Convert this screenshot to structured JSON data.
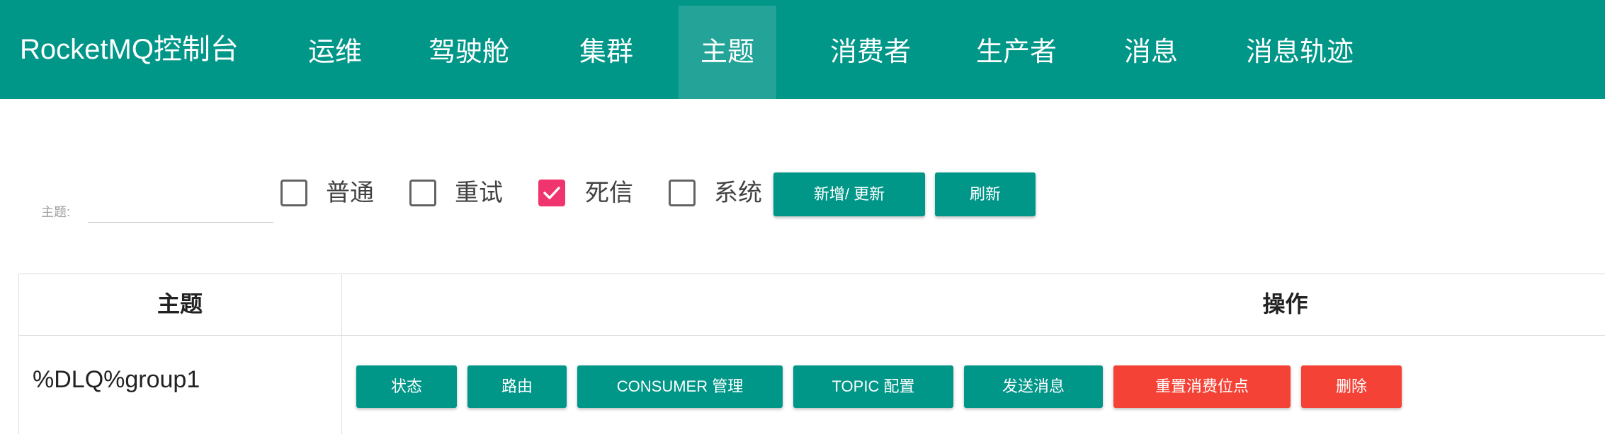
{
  "navbar": {
    "brand": "RocketMQ控制台",
    "items": [
      {
        "label": "运维"
      },
      {
        "label": "驾驶舱"
      },
      {
        "label": "集群"
      },
      {
        "label": "主题"
      },
      {
        "label": "消费者"
      },
      {
        "label": "生产者"
      },
      {
        "label": "消息"
      },
      {
        "label": "消息轨迹"
      }
    ],
    "active_item": "主题"
  },
  "filter": {
    "topic_label": "主题:",
    "topic_value": "",
    "checkboxes": [
      {
        "label": "普通",
        "checked": false
      },
      {
        "label": "重试",
        "checked": false
      },
      {
        "label": "死信",
        "checked": true
      },
      {
        "label": "系统",
        "checked": false
      }
    ],
    "add_update_button": "新增/ 更新",
    "refresh_button": "刷新"
  },
  "table": {
    "headers": [
      "主题",
      "操作"
    ],
    "rows": [
      {
        "topic": "%DLQ%group1",
        "actions": [
          {
            "label": "状态",
            "style": "teal"
          },
          {
            "label": "路由",
            "style": "teal"
          },
          {
            "label": "CONSUMER 管理",
            "style": "teal"
          },
          {
            "label": "TOPIC 配置",
            "style": "teal"
          },
          {
            "label": "发送消息",
            "style": "teal"
          },
          {
            "label": "重置消费位点",
            "style": "red"
          },
          {
            "label": "删除",
            "style": "red"
          }
        ]
      }
    ]
  },
  "colors": {
    "primary": "#009688",
    "checkbox_checked": "#f0346e",
    "danger": "#f44336"
  }
}
